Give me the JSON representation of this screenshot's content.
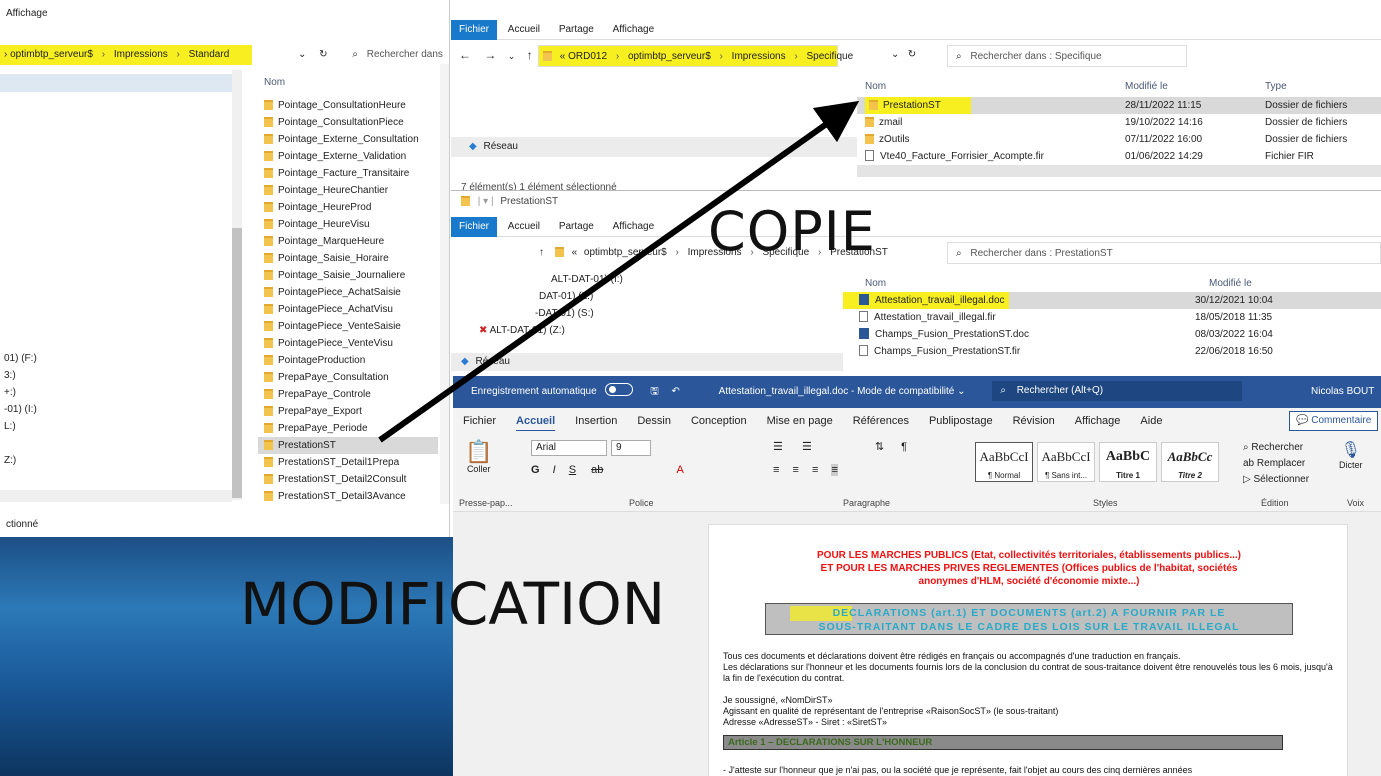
{
  "left_explorer": {
    "menu": "Affichage",
    "breadcrumb": [
      "optimbtp_serveur$",
      "Impressions",
      "Standard"
    ],
    "search_placeholder": "Rechercher dans",
    "column_name": "Nom",
    "items": [
      "Pointage_ConsultationHeure",
      "Pointage_ConsultationPiece",
      "Pointage_Externe_Consultation",
      "Pointage_Externe_Validation",
      "Pointage_Facture_Transitaire",
      "Pointage_HeureChantier",
      "Pointage_HeureProd",
      "Pointage_HeureVisu",
      "Pointage_MarqueHeure",
      "Pointage_Saisie_Horaire",
      "Pointage_Saisie_Journaliere",
      "PointagePiece_AchatSaisie",
      "PointagePiece_AchatVisu",
      "PointagePiece_VenteSaisie",
      "PointagePiece_VenteVisu",
      "PointageProduction",
      "PrepaPaye_Consultation",
      "PrepaPaye_Controle",
      "PrepaPaye_Export",
      "PrepaPaye_Periode",
      "PrestationST",
      "PrestationST_Detail1Prepa",
      "PrestationST_Detail2Consult",
      "PrestationST_Detail3Avance"
    ],
    "selected_index": 20,
    "nav_drives": [
      "01) (F:)",
      "3:)",
      "+:)",
      "-01) (I:)",
      "L:)",
      "Z:)"
    ],
    "status": "ctionné"
  },
  "top_explorer": {
    "tabs": [
      "Fichier",
      "Accueil",
      "Partage",
      "Affichage"
    ],
    "breadcrumb": [
      "« ORD012",
      "optimbtp_serveur$",
      "Impressions",
      "Specifique"
    ],
    "search_placeholder": "Rechercher dans : Specifique",
    "columns": [
      "Nom",
      "Modifié le",
      "Type"
    ],
    "rows": [
      {
        "name": "PrestationST",
        "date": "28/11/2022 11:15",
        "type": "Dossier de fichiers"
      },
      {
        "name": "zmail",
        "date": "19/10/2022 14:16",
        "type": "Dossier de fichiers"
      },
      {
        "name": "zOutils",
        "date": "07/11/2022 16:00",
        "type": "Dossier de fichiers"
      },
      {
        "name": "Vte40_Facture_Forrisier_Acompte.fir",
        "date": "01/06/2022 14:29",
        "type": "Fichier FIR"
      }
    ],
    "nav_item": "Réseau",
    "status": "7 élément(s)    1 élément sélectionné"
  },
  "mid_explorer": {
    "title": "PrestationST",
    "tabs": [
      "Fichier",
      "Accueil",
      "Partage",
      "Affichage"
    ],
    "breadcrumb": [
      "«",
      "optimbtp_serveur$",
      "Impressions",
      "Specifique",
      "PrestationST"
    ],
    "search_placeholder": "Rechercher dans : PrestationST",
    "columns": [
      "Nom",
      "Modifié le"
    ],
    "rows": [
      {
        "name": "Attestation_travail_illegal.doc",
        "date": "30/12/2021 10:04",
        "kind": "doc"
      },
      {
        "name": "Attestation_travail_illegal.fir",
        "date": "18/05/2018 11:35",
        "kind": "file"
      },
      {
        "name": "Champs_Fusion_PrestationST.doc",
        "date": "08/03/2022 16:04",
        "kind": "doc"
      },
      {
        "name": "Champs_Fusion_PrestationST.fir",
        "date": "22/06/2018 16:50",
        "kind": "file"
      }
    ],
    "drives": [
      "ALT-DAT-01) (I:)",
      "DAT-01) (L:)",
      "-DAT-01) (S:)",
      "ALT-DAT-01) (Z:)"
    ],
    "nav_item": "Réseau"
  },
  "word": {
    "autosave": "Enregistrement automatique",
    "doc_title": "Attestation_travail_illegal.doc  -  Mode de compatibilité",
    "search": "Rechercher (Alt+Q)",
    "user": "Nicolas BOUT",
    "tabs": [
      "Fichier",
      "Accueil",
      "Insertion",
      "Dessin",
      "Conception",
      "Mise en page",
      "Références",
      "Publipostage",
      "Révision",
      "Affichage",
      "Aide"
    ],
    "comments": "Commentaire",
    "font": "Arial",
    "size": "9",
    "paste": "Coller",
    "styles": [
      {
        "sample": "AaBbCcI",
        "name": "¶ Normal"
      },
      {
        "sample": "AaBbCcI",
        "name": "¶ Sans int..."
      },
      {
        "sample": "AaBbC",
        "name": "Titre 1"
      },
      {
        "sample": "AaBbCc",
        "name": "Titre 2"
      }
    ],
    "edit_items": [
      "Rechercher",
      "Remplacer",
      "Sélectionner"
    ],
    "dictate": "Dicter",
    "groups": [
      "Presse-pap...",
      "Police",
      "Paragraphe",
      "Styles",
      "Édition",
      "Voix"
    ],
    "page": {
      "red_lines": [
        "POUR LES MARCHES PUBLICS (Etat, collectivités territoriales, établissements publics...)",
        "ET POUR LES MARCHES PRIVES REGLEMENTES (Offices publics de l'habitat, sociétés",
        "anonymes d'HLM, société d'économie mixte...)"
      ],
      "decl_line1": "DECLARATIONS (art.1) ET DOCUMENTS (art.2) A FOURNIR PAR LE",
      "decl_line2": "SOUS-TRAITANT DANS LE CADRE DES LOIS SUR LE TRAVAIL ILLEGAL",
      "para1": "Tous ces documents et déclarations doivent être rédigés en français ou accompagnés d'une traduction en français.",
      "para2": "Les déclarations sur l'honneur et les documents fournis lors de la conclusion du contrat de sous-traitance doivent être renouvelés tous les 6 mois, jusqu'à la fin de l'exécution du contrat.",
      "sig1": "Je soussigné, «NomDirST»",
      "sig2": "Agissant en qualité de représentant de l'entreprise «RaisonSocST» (le sous-traitant)",
      "sig3": "Adresse «AdresseST» - Siret : «SiretST»",
      "article1": "Article 1 – DECLARATIONS SUR L'HONNEUR",
      "bullet": "-   J'atteste sur l'honneur que je n'ai pas, ou la société que je représente, fait l'objet au cours des cinq dernières années"
    }
  },
  "overlay": {
    "copie": "COPIE",
    "modification": "MODIFICATION"
  }
}
